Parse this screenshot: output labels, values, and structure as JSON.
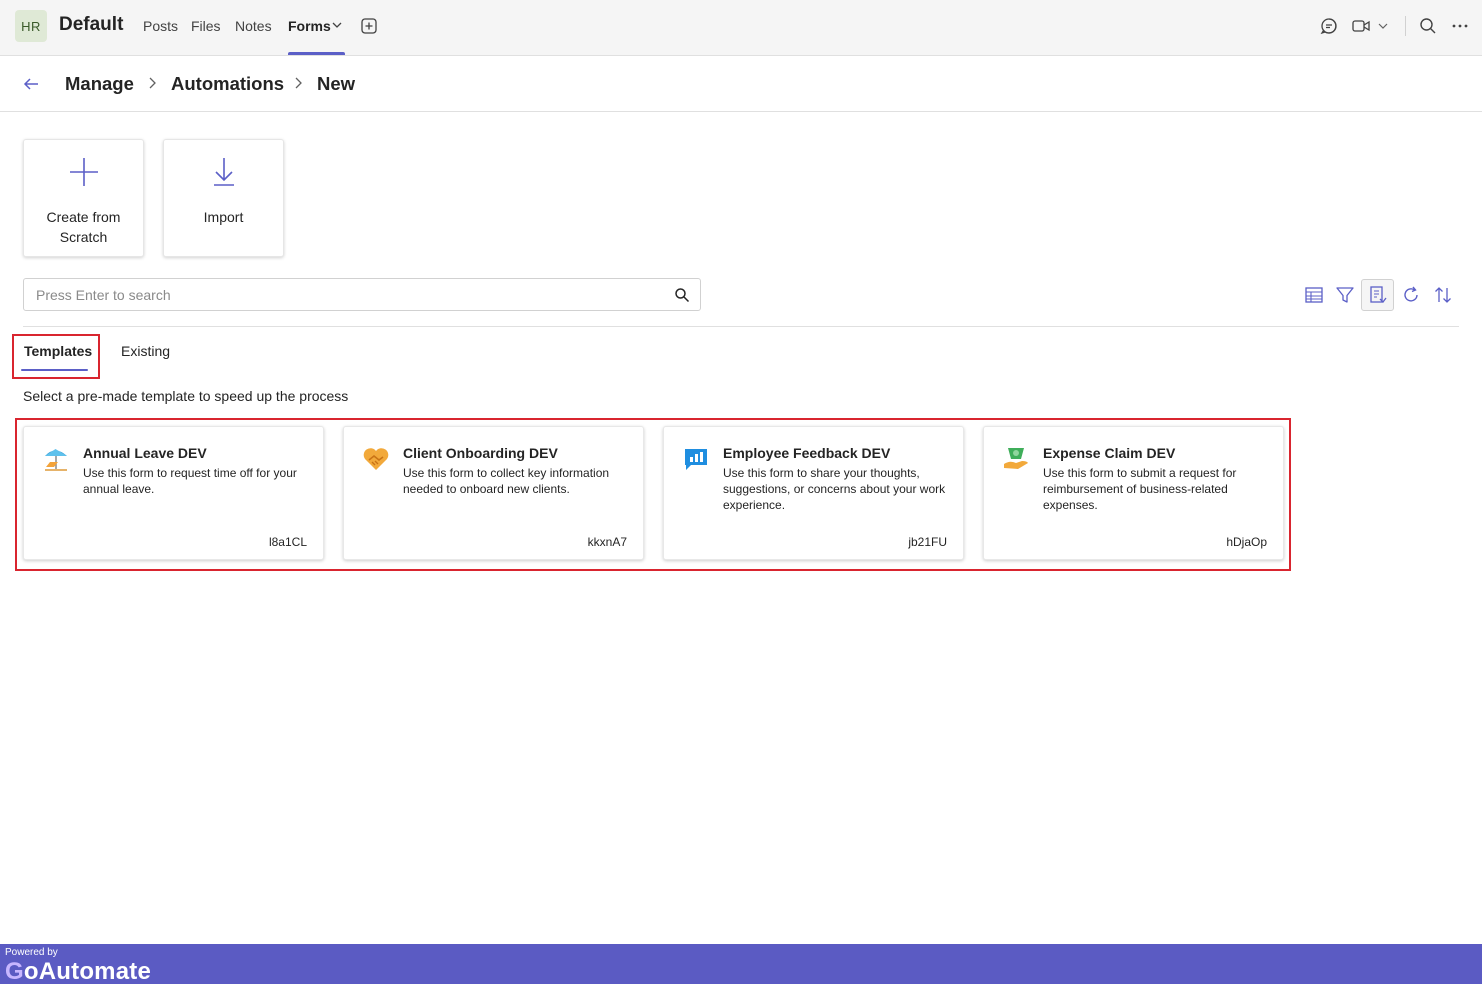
{
  "header": {
    "team_initials": "HR",
    "team_name": "Default",
    "tabs": [
      {
        "label": "Posts"
      },
      {
        "label": "Files"
      },
      {
        "label": "Notes"
      },
      {
        "label": "Forms"
      }
    ],
    "active_tab": "Forms"
  },
  "breadcrumb": {
    "items": [
      "Manage",
      "Automations",
      "New"
    ]
  },
  "actions": {
    "create_label": "Create from Scratch",
    "import_label": "Import"
  },
  "search": {
    "placeholder": "Press Enter to search"
  },
  "pivot": {
    "templates": "Templates",
    "existing": "Existing"
  },
  "hint": "Select a pre-made template to speed up the process",
  "templates": [
    {
      "title": "Annual Leave DEV",
      "description": "Use this form to request time off for your annual leave.",
      "code": "l8a1CL",
      "icon": "beach-umbrella-icon"
    },
    {
      "title": "Client Onboarding DEV",
      "description": "Use this form to collect key information needed to onboard new clients.",
      "code": "kkxnA7",
      "icon": "handshake-heart-icon"
    },
    {
      "title": "Employee Feedback DEV",
      "description": "Use this form to share your thoughts, suggestions, or concerns about your work experience.",
      "code": "jb21FU",
      "icon": "chat-chart-icon"
    },
    {
      "title": "Expense Claim DEV",
      "description": "Use this form to submit a request for reimbursement of business-related expenses.",
      "code": "hDjaOp",
      "icon": "money-hand-icon"
    }
  ],
  "footer": {
    "powered_by": "Powered by",
    "brand_g": "G",
    "brand_rest": "oAutomate"
  },
  "colors": {
    "accent": "#5b5fc7",
    "highlight": "#d9252f",
    "footer": "#5b5bc3"
  }
}
